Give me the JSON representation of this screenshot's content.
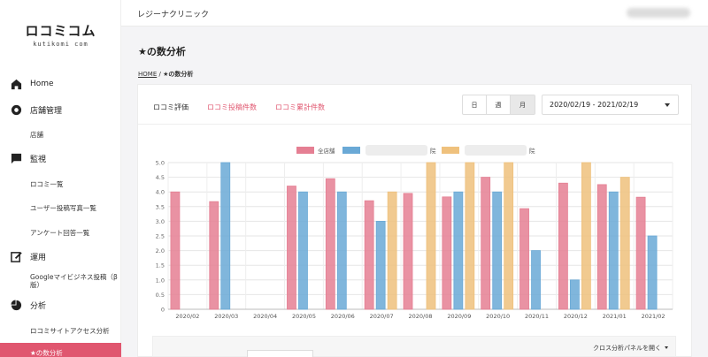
{
  "sidebar": {
    "logo": "ロコミコム",
    "logo_sub": "kutikomi com",
    "home": "Home",
    "store_mgmt": "店舗管理",
    "stores": "店舗",
    "monitor": "監視",
    "review_list": "ロコミ一覧",
    "user_photos": "ユーザー投稿写真一覧",
    "survey": "アンケート回答一覧",
    "operation": "運用",
    "gbp_post": "Googleマイビジネス投稿（β版）",
    "analysis": "分析",
    "site_access": "ロコミサイトアクセス分析",
    "star_analysis": "★の数分析"
  },
  "header": {
    "clinic": "レジーナクリニック"
  },
  "page": {
    "title": "★の数分析",
    "crumb_home": "HOME",
    "crumb_sep": "/",
    "crumb_current": "★の数分析"
  },
  "tabs": {
    "rating": "ロコミ評価",
    "posts": "ロコミ投稿件数",
    "cumulative": "ロコミ累計件数"
  },
  "period": {
    "day": "日",
    "week": "週",
    "month": "月",
    "range": "2020/02/19 - 2021/02/19"
  },
  "cross_panel": "クロス分析パネルを開く",
  "colors": {
    "accent": "#e0566f",
    "red": "#e57f93",
    "blue": "#6aa9d6",
    "orange": "#efc17d"
  },
  "chart_data": {
    "type": "bar",
    "categories": [
      "2020/02",
      "2020/03",
      "2020/04",
      "2020/05",
      "2020/06",
      "2020/07",
      "2020/08",
      "2020/09",
      "2020/10",
      "2020/11",
      "2020/12",
      "2021/01",
      "2021/02"
    ],
    "series": [
      {
        "name": "全店舗",
        "color": "#e57f93",
        "values": [
          4.0,
          3.67,
          null,
          4.2,
          4.45,
          3.7,
          3.95,
          3.83,
          4.5,
          3.43,
          4.3,
          4.25,
          3.82
        ]
      },
      {
        "name": "",
        "color": "#6aa9d6",
        "values": [
          null,
          5.0,
          null,
          4.0,
          4.0,
          3.0,
          null,
          4.0,
          4.0,
          2.0,
          1.0,
          4.0,
          2.5
        ]
      },
      {
        "name": "",
        "color": "#efc17d",
        "values": [
          null,
          null,
          null,
          null,
          null,
          4.0,
          5.0,
          5.0,
          5.0,
          null,
          5.0,
          4.5,
          null
        ]
      }
    ],
    "legend_partial": [
      "院",
      "院"
    ],
    "ylim": [
      0,
      5
    ],
    "yticks": [
      "0",
      "0.5",
      "1.0",
      "1.5",
      "2.0",
      "2.5",
      "3.0",
      "3.5",
      "4.0",
      "4.5",
      "5.0"
    ],
    "grid": true,
    "legend_position": "top-center"
  }
}
